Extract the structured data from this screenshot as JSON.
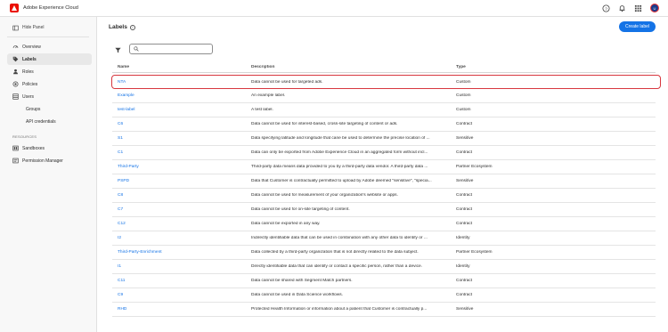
{
  "app": {
    "title": "Adobe Experience Cloud",
    "avatar_initials": "U",
    "brand_color": "#eb1000",
    "accent_color": "#1473e6"
  },
  "topbar": {
    "icons": [
      "help-icon",
      "bell-icon",
      "apps-grid-icon"
    ]
  },
  "sidebar": {
    "hide_label": "Hide Panel",
    "items": [
      {
        "label": "Overview",
        "icon": "overview-icon"
      },
      {
        "label": "Labels",
        "icon": "tag-icon",
        "active": true
      },
      {
        "label": "Roles",
        "icon": "user-icon"
      },
      {
        "label": "Policies",
        "icon": "policy-icon"
      },
      {
        "label": "Users",
        "icon": "users-icon"
      }
    ],
    "sub_items": [
      {
        "label": "Groups"
      },
      {
        "label": "API credentials"
      }
    ],
    "resources_heading": "RESOURCES",
    "resources": [
      {
        "label": "Sandboxes",
        "icon": "sandbox-icon"
      },
      {
        "label": "Permission Manager",
        "icon": "permission-icon"
      }
    ]
  },
  "main": {
    "title": "Labels",
    "create_button": "Create label",
    "search": {
      "value": "",
      "placeholder": ""
    },
    "table": {
      "headers": [
        "Name",
        "Description",
        "Type"
      ],
      "rows": [
        {
          "name": "NTA",
          "description": "Data cannot be used for targeted ads.",
          "type": "Custom"
        },
        {
          "name": "Example",
          "description": "An example label.",
          "type": "Custom"
        },
        {
          "name": "test-label",
          "description": "A test label.",
          "type": "Custom"
        },
        {
          "name": "C6",
          "description": "Data cannot be used for interest-based, cross-site targeting of content or ads.",
          "type": "Contract"
        },
        {
          "name": "S1",
          "description": "Data specifying latitude and longitude that cane be used to determine the precise location of ...",
          "type": "Sensitive"
        },
        {
          "name": "C1",
          "description": "Data can only be exported from Adobe Experience Cloud in an aggregated form without incl...",
          "type": "Contract"
        },
        {
          "name": "Third-Party",
          "description": "Third-party data means data provided to you by a third-party data vendor. A third-party data ...",
          "type": "Partner Ecosystem"
        },
        {
          "name": "PSPD",
          "description": "Data that Customer is contractually permitted to upload by Adobe deemed \"sensitive\", \"specia...",
          "type": "Sensitive"
        },
        {
          "name": "C8",
          "description": "Data cannot be used for measurement of your organization's website or apps.",
          "type": "Contract"
        },
        {
          "name": "C7",
          "description": "Data cannot be used for on-site targeting of content.",
          "type": "Contract"
        },
        {
          "name": "C12",
          "description": "Data cannot be exported in any way.",
          "type": "Contract"
        },
        {
          "name": "I2",
          "description": "Indirectly identifiable data that can be used in combination with any other data to identify or ...",
          "type": "Identity"
        },
        {
          "name": "Third-Party-Enrichment",
          "description": "Data collected by a third-party organization that is not directly related to the data subject.",
          "type": "Partner Ecosystem"
        },
        {
          "name": "I1",
          "description": "Directly identifiable data that can identify or contact a specific person, rather than a device.",
          "type": "Identity"
        },
        {
          "name": "C11",
          "description": "Data cannot be shared with Segment Match partners.",
          "type": "Contract"
        },
        {
          "name": "C9",
          "description": "Data cannot be used in Data Science workflows.",
          "type": "Contract"
        },
        {
          "name": "RHD",
          "description": "Protected Health Information or information about a patient that Customer is contractually p...",
          "type": "Sensitive"
        }
      ]
    }
  }
}
